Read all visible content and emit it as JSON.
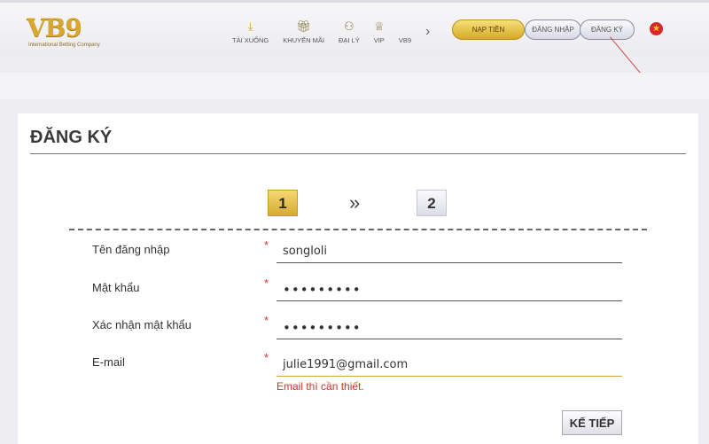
{
  "header": {
    "logo_text": "VB9",
    "logo_subtitle": "International Betting Company",
    "nav": [
      {
        "label": "TẢI XUỐNG",
        "icon": "download-icon"
      },
      {
        "label": "KHUYẾN MÃI",
        "icon": "gift-icon"
      },
      {
        "label": "ĐẠI LÝ",
        "icon": "agent-icon"
      },
      {
        "label": "VIP",
        "icon": "vip-basket-icon"
      },
      {
        "label": "VB9",
        "icon": ""
      }
    ],
    "deposit_label": "NẠP TIỀN",
    "login_label": "ĐĂNG NHẬP",
    "register_label": "ĐĂNG KÝ",
    "language_flag": "vietnam-flag-icon"
  },
  "form": {
    "title": "ĐĂNG KÝ",
    "steps": [
      "1",
      "2"
    ],
    "step_separator": "»",
    "active_step": 1,
    "fields": [
      {
        "label": "Tên đăng nhập",
        "value": "songloli",
        "required_mark": "*"
      },
      {
        "label": "Mật khẩu",
        "value": "•••••••••",
        "required_mark": "*"
      },
      {
        "label": "Xác nhận mật khẩu",
        "value": "•••••••••",
        "required_mark": "*"
      },
      {
        "label": "E-mail",
        "value": "julie1991@gmail.com",
        "required_mark": "*"
      }
    ],
    "email_error": "Email thì cần thiết.",
    "next_label": "KẾ TIẾP"
  },
  "colors": {
    "gold_accent": "#d7a730",
    "error": "#c0392b",
    "required": "#d0302f"
  }
}
